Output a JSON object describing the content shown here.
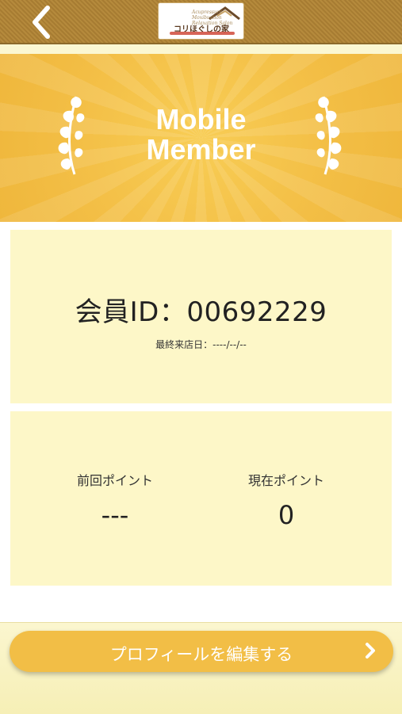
{
  "header": {
    "logo": {
      "small_text": "Acupressure\nMoxibustion\nRelaxation Salon",
      "brand": "コリほぐしの家"
    }
  },
  "hero": {
    "title_line1": "Mobile",
    "title_line2": "Member"
  },
  "member": {
    "id_label": "会員ID：00692229",
    "last_visit": "最終来店日：----/--/--"
  },
  "points": {
    "previous_label": "前回ポイント",
    "previous_value": "---",
    "current_label": "現在ポイント",
    "current_value": "0"
  },
  "actions": {
    "edit_profile": "プロフィールを編集する"
  },
  "colors": {
    "header_brown": "#b58a3c",
    "accent_yellow": "#f2be46",
    "card_bg": "#fdf7c8"
  }
}
